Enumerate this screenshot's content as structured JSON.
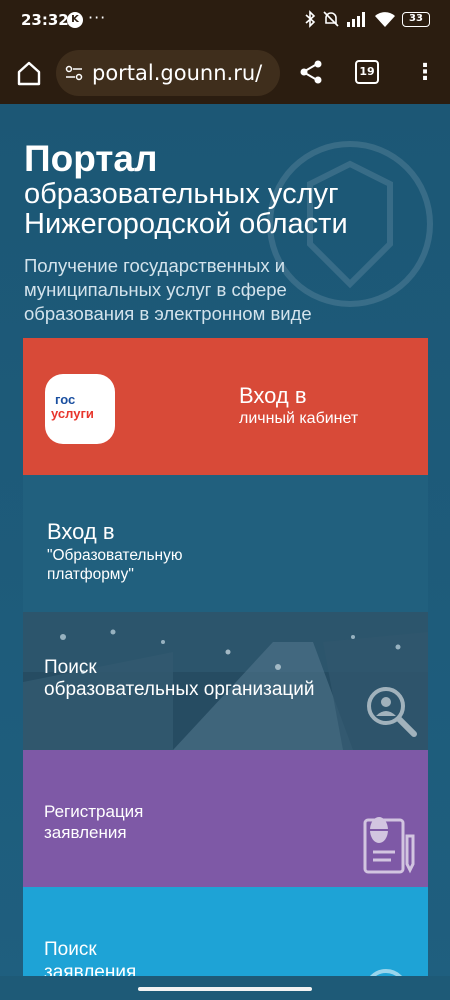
{
  "status_bar": {
    "time": "23:32",
    "k_badge": "K",
    "dots": "···",
    "battery": "33"
  },
  "browser": {
    "url": "portal.gounn.ru/",
    "tabs_count": "19",
    "menu_glyph": "⋮"
  },
  "hero": {
    "title": "Портал",
    "subtitle_line1": "образовательных услуг",
    "subtitle_line2": "Нижегородской области",
    "description": "Получение государственных и муниципальных услуг в сфере образования в электронном виде"
  },
  "tiles": {
    "gosuslugi": {
      "logo_line1": "гос",
      "logo_line2": "услуги",
      "line1": "Вход в",
      "line2": "личный кабинет",
      "color": "#d84a38"
    },
    "edu_platform": {
      "line1": "Вход в",
      "line2": "\"Образовательную",
      "line3": "платформу\"",
      "color": "#21607e"
    },
    "search_org": {
      "line1": "Поиск",
      "line2": "образовательных организаций",
      "icon": "search-magnifier-icon"
    },
    "registration": {
      "line1": "Регистрация",
      "line2": "заявления",
      "color": "#7e59a6",
      "icon": "document-mouse-icon"
    },
    "search_app": {
      "line1": "Поиск",
      "line2": "заявления",
      "color": "#1ea3d6",
      "icon": "search-document-icon"
    }
  }
}
